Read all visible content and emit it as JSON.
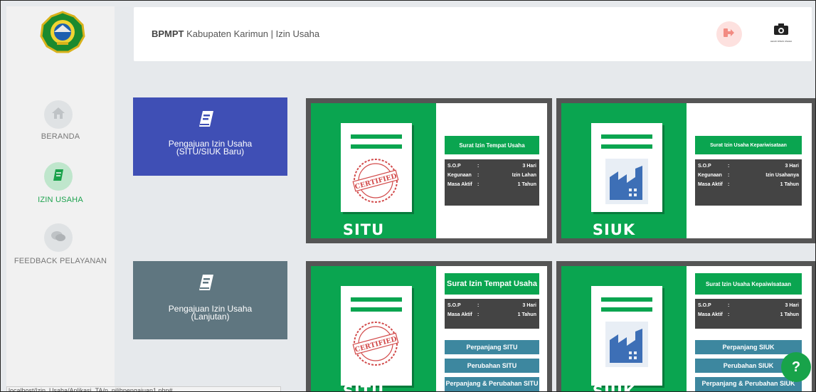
{
  "header": {
    "org": "BPMPT",
    "title": "Kabupaten Karimun | Izin Usaha",
    "separator": " "
  },
  "sidebar": {
    "items": [
      {
        "label": "BERANDA",
        "icon": "home-icon",
        "active": false
      },
      {
        "label": "IZIN USAHA",
        "icon": "book-icon",
        "active": true
      },
      {
        "label": "FEEDBACK PELAYANAN",
        "icon": "comments-icon",
        "active": false
      }
    ]
  },
  "avatar": {
    "caption": "LEGIO DINAS USAHA"
  },
  "tiles": [
    {
      "line1": "Pengajuan Izin Usaha",
      "line2": "(SITU/SIUK Baru)",
      "color": "#3f4fb5"
    },
    {
      "line1": "Pengajuan Izin Usaha",
      "line2": "(Lanjutan)",
      "color": "#5f7680"
    }
  ],
  "cards_top": [
    {
      "name": "SITU",
      "heading": "Surat Izin Tempat Usaha",
      "stamp": "CERTIFIED",
      "rows": [
        {
          "k": "S.O.P",
          "sep": ":",
          "v": "3 Hari"
        },
        {
          "k": "Kegunaan",
          "sep": ":",
          "v": "Izin Lahan"
        },
        {
          "k": "Masa Aktif",
          "sep": ":",
          "v": "1 Tahun"
        }
      ]
    },
    {
      "name": "SIUK",
      "heading": "Surat Izin Usaha Kepariwisataan",
      "rows": [
        {
          "k": "S.O.P",
          "sep": ":",
          "v": "3 Hari"
        },
        {
          "k": "Kegunaan",
          "sep": ":",
          "v": "Izin Usahanya"
        },
        {
          "k": "Masa Aktif",
          "sep": ":",
          "v": "1 Tahun"
        }
      ]
    }
  ],
  "cards_bottom": [
    {
      "name": "SITU",
      "heading": "Surat Izin Tempat Usaha",
      "stamp": "CERTIFIED",
      "rows": [
        {
          "k": "S.O.P",
          "sep": ":",
          "v": "3 Hari"
        },
        {
          "k": "Masa Aktif",
          "sep": ":",
          "v": "1 Tahun"
        }
      ],
      "buttons": [
        "Perpanjang SITU",
        "Perubahan SITU",
        "Perpanjang & Perubahan SITU"
      ]
    },
    {
      "name": "SIUK",
      "heading": "Surat Izin Usaha Kepaiwisataan",
      "rows": [
        {
          "k": "S.O.P",
          "sep": ":",
          "v": "3 Hari"
        },
        {
          "k": "Masa Aktif",
          "sep": ":",
          "v": "1 Tahun"
        }
      ],
      "buttons": [
        "Perpanjang SIUK",
        "Perubahan SIUK",
        "Perpanjang & Perubahan SIUK"
      ]
    }
  ],
  "help": {
    "label": "?"
  },
  "status": {
    "url": "localhost/Izin_Usaha/Aplikasi_TA/p_pilihpengajuan1.php#"
  },
  "colors": {
    "green": "#0aa550",
    "blue_tile": "#3f4fb5",
    "grey_tile": "#5f7680",
    "teal_btn": "#3d879f"
  }
}
